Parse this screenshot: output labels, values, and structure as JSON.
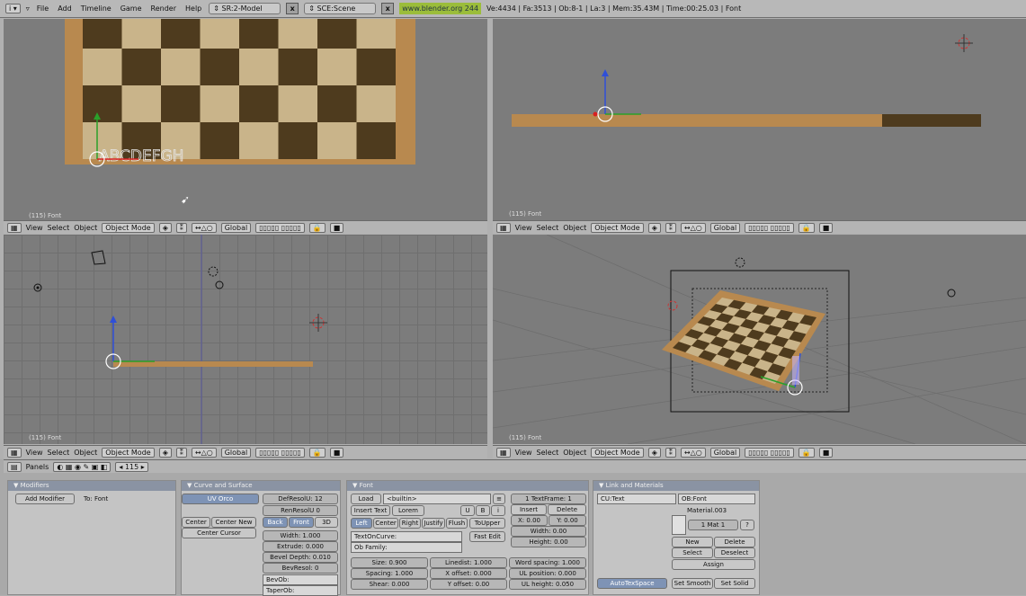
{
  "topbar": {
    "menus": [
      "File",
      "Add",
      "Timeline",
      "Game",
      "Render",
      "Help"
    ],
    "screen": "SR:2-Model",
    "scene": "SCE:Scene",
    "site": "www.blender.org 244",
    "stats": "Ve:4434 | Fa:3513 | Ob:8-1 | La:3  | Mem:35.43M  | Time:00:25.03 | Font"
  },
  "viewport": {
    "frame_label": "(115) Font",
    "menus": [
      "View",
      "Select",
      "Object"
    ],
    "mode": "Object Mode",
    "orientation": "Global",
    "board_letters": "ABCDEFGH"
  },
  "buttons_header": {
    "menu": "Panels",
    "frame": "115"
  },
  "modifiers": {
    "title": "Modifiers",
    "add_modifier": "Add Modifier",
    "to": "To: Font"
  },
  "curve": {
    "title": "Curve and Surface",
    "uv_orco": "UV Orco",
    "def_resol": "DefResolU: 12",
    "ren_resol": "RenResolU 0",
    "center": "Center",
    "center_new": "Center New",
    "center_cursor": "Center Cursor",
    "back": "Back",
    "front": "Front",
    "three_d": "3D",
    "width": "Width: 1.000",
    "extrude": "Extrude: 0.000",
    "bevel_depth": "Bevel Depth: 0.010",
    "bev_resol": "BevResol: 0",
    "bevob": "BevOb:",
    "taperob": "TaperOb:"
  },
  "font": {
    "title": "Font",
    "load": "Load",
    "builtin": "<builtin>",
    "insert_text": "Insert Text",
    "lorem": "Lorem",
    "u": "U",
    "b": "B",
    "i": "i",
    "align": [
      "Left",
      "Center",
      "Right",
      "Justify",
      "Flush"
    ],
    "toupper": "ToUpper",
    "text_on_curve": "TextOnCurve:",
    "ob_family": "Ob Family:",
    "fast_edit": "Fast Edit",
    "textframe": "1 TextFrame: 1",
    "insert": "Insert",
    "delete": "Delete",
    "x": "X: 0.00",
    "y": "Y: 0.00",
    "fwidth": "Width: 0.00",
    "fheight": "Height: 0.00",
    "size": "Size: 0.900",
    "linedist": "Linedist: 1.000",
    "word_spacing": "Word spacing: 1.000",
    "spacing": "Spacing: 1.000",
    "x_offset": "X offset: 0.000",
    "ul_position": "UL position: 0.000",
    "shear": "Shear: 0.000",
    "y_offset": "Y offset: 0.00",
    "ul_height": "UL height: 0.050"
  },
  "link": {
    "title": "Link and Materials",
    "cu": "CU:Text",
    "ob": "OB:Font",
    "material": "Material.003",
    "mat": "1 Mat 1",
    "q": "?",
    "new": "New",
    "delete": "Delete",
    "select": "Select",
    "deselect": "Deselect",
    "assign": "Assign",
    "autotex": "AutoTexSpace",
    "set_smooth": "Set Smooth",
    "set_solid": "Set Solid"
  },
  "colors": {
    "viewport_bg": "#7c7c7c",
    "wood": "#b8894f",
    "dark_square": "#4e3b1e",
    "light_square": "#c9b48a"
  }
}
